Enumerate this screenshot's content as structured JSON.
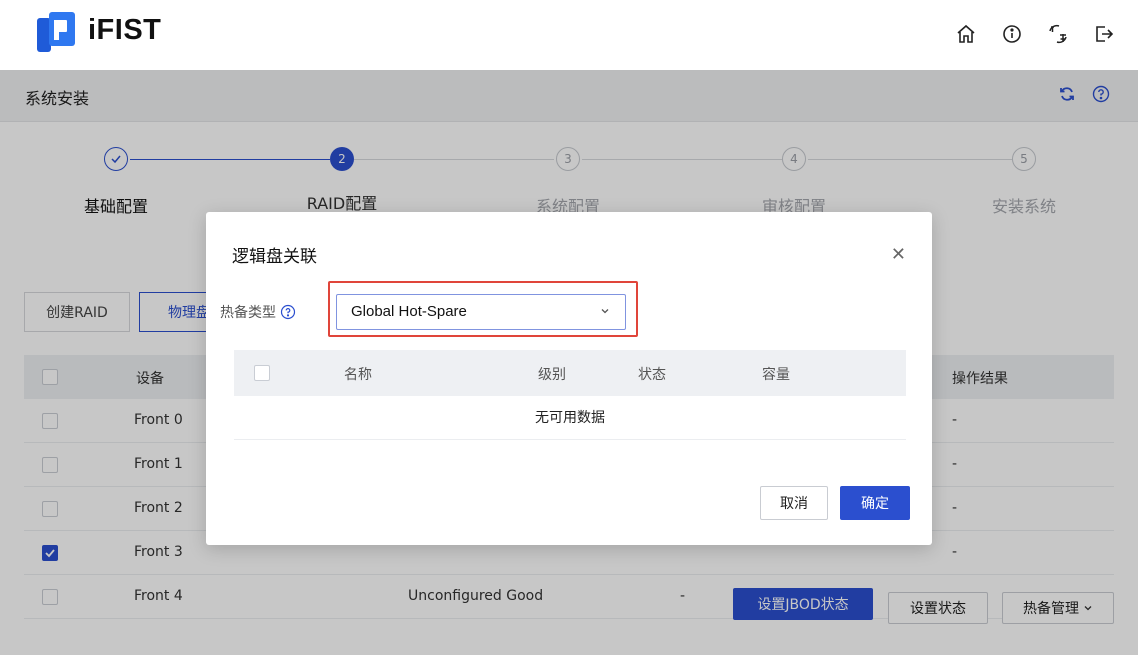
{
  "header": {
    "brand": "iFIST"
  },
  "page": {
    "title": "系统安装"
  },
  "steps": [
    {
      "num": "✓",
      "label": "基础配置",
      "state": "done"
    },
    {
      "num": "2",
      "label": "RAID配置",
      "state": "active"
    },
    {
      "num": "3",
      "label": "系统配置",
      "state": "pending"
    },
    {
      "num": "4",
      "label": "审核配置",
      "state": "pending"
    },
    {
      "num": "5",
      "label": "安装系统",
      "state": "pending"
    }
  ],
  "tabs": {
    "create_raid": "创建RAID",
    "physical_disk": "物理盘"
  },
  "table": {
    "col_device": "设备",
    "col_result": "操作结果",
    "rows": [
      {
        "device": "Front 0",
        "status": "",
        "extra": "",
        "result": "-",
        "checked": false
      },
      {
        "device": "Front 1",
        "status": "",
        "extra": "",
        "result": "-",
        "checked": false
      },
      {
        "device": "Front 2",
        "status": "",
        "extra": "",
        "result": "-",
        "checked": false
      },
      {
        "device": "Front 3",
        "status": "",
        "extra": "",
        "result": "-",
        "checked": true
      },
      {
        "device": "Front 4",
        "status": "Unconfigured Good",
        "extra": "-",
        "result": "-",
        "checked": false
      }
    ]
  },
  "actions": {
    "set_jbod": "设置JBOD状态",
    "set_state": "设置状态",
    "hotspare": "热备管理"
  },
  "modal": {
    "title": "逻辑盘关联",
    "field_label": "热备类型",
    "select_value": "Global Hot-Spare",
    "col_name": "名称",
    "col_level": "级别",
    "col_status": "状态",
    "col_capacity": "容量",
    "empty": "无可用数据",
    "cancel": "取消",
    "confirm": "确定"
  },
  "colors": {
    "primary": "#2b4fcf",
    "highlight": "#e0453a",
    "brand": "#1f5bd8"
  }
}
